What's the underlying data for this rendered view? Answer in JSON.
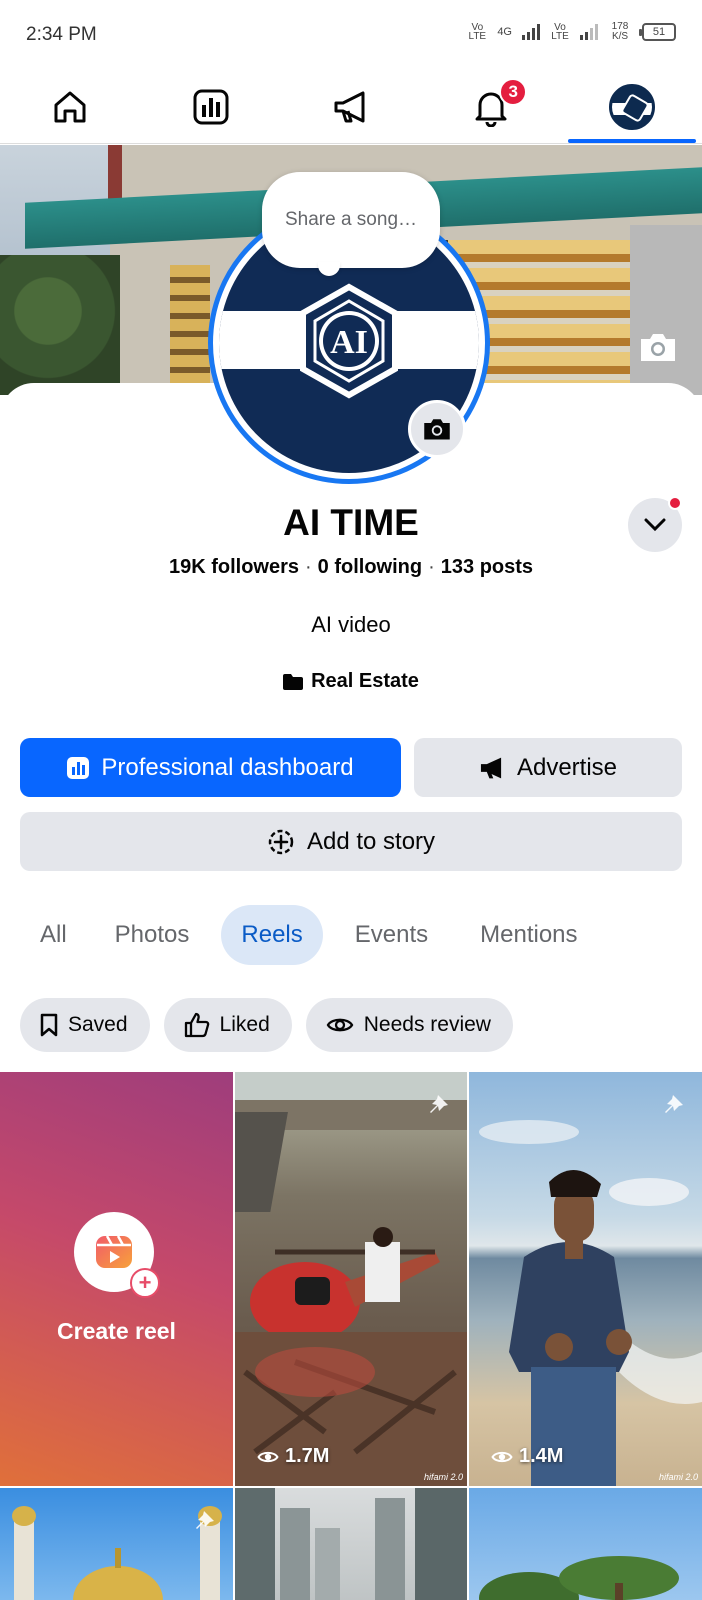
{
  "status_bar": {
    "time": "2:34 PM",
    "net1": "Vo LTE",
    "net_type": "4G",
    "net2": "Vo LTE",
    "speed": "178 K/S",
    "battery": "51"
  },
  "nav": {
    "tabs": [
      {
        "name": "home",
        "icon": "home-icon"
      },
      {
        "name": "dashboard",
        "icon": "chart-icon"
      },
      {
        "name": "advertise",
        "icon": "megaphone-icon"
      },
      {
        "name": "notifications",
        "icon": "bell-icon",
        "badge": "3"
      },
      {
        "name": "profile",
        "icon": "avatar",
        "active": true
      }
    ]
  },
  "profile": {
    "share_song_placeholder": "Share a song…",
    "name": "AI TIME",
    "followers": "19K followers",
    "following": "0 following",
    "posts": "133 posts",
    "separator": "·",
    "bio": "AI video",
    "category": "Real Estate",
    "logo_text": "AI"
  },
  "actions": {
    "professional_dashboard": "Professional dashboard",
    "advertise": "Advertise",
    "add_to_story": "Add to story"
  },
  "content_tabs": [
    {
      "label": "All"
    },
    {
      "label": "Photos"
    },
    {
      "label": "Reels",
      "active": true
    },
    {
      "label": "Events"
    },
    {
      "label": "Mentions"
    }
  ],
  "filters": [
    {
      "label": "Saved",
      "icon": "bookmark-icon"
    },
    {
      "label": "Liked",
      "icon": "thumbs-up-icon"
    },
    {
      "label": "Needs review",
      "icon": "eye-icon"
    }
  ],
  "reels": {
    "create_label": "Create reel",
    "items": [
      {
        "views": "1.7M",
        "pinned": true,
        "watermark": "hifami 2.0"
      },
      {
        "views": "1.4M",
        "pinned": true,
        "watermark": "hifami 2.0"
      }
    ]
  },
  "colors": {
    "accent": "#0866ff",
    "badge": "#e41e3f",
    "chip_bg": "#e4e6eb",
    "active_tab_bg": "#dbe7f7"
  }
}
